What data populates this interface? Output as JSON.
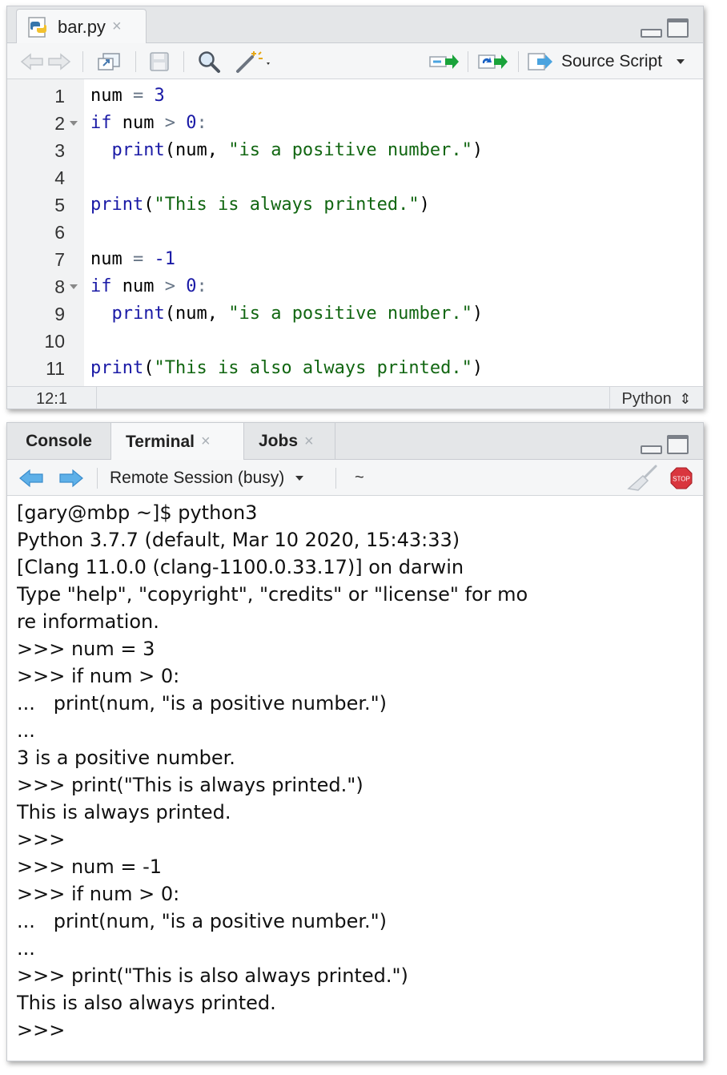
{
  "editor": {
    "file_tab": "bar.py",
    "tab_close": "×",
    "source_script_label": "Source Script",
    "lines": [
      [
        {
          "t": "num",
          "c": "p"
        },
        {
          "t": " ",
          "c": "p"
        },
        {
          "t": "=",
          "c": "op"
        },
        {
          "t": " ",
          "c": "p"
        },
        {
          "t": "3",
          "c": "num"
        }
      ],
      [
        {
          "t": "if",
          "c": "kw"
        },
        {
          "t": " num ",
          "c": "p"
        },
        {
          "t": ">",
          "c": "op"
        },
        {
          "t": " ",
          "c": "p"
        },
        {
          "t": "0",
          "c": "num"
        },
        {
          "t": ":",
          "c": "op"
        }
      ],
      [
        {
          "t": "  ",
          "c": "p"
        },
        {
          "t": "print",
          "c": "fn"
        },
        {
          "t": "(num, ",
          "c": "p"
        },
        {
          "t": "\"is a positive number.\"",
          "c": "str"
        },
        {
          "t": ")",
          "c": "p"
        }
      ],
      [],
      [
        {
          "t": "print",
          "c": "fn"
        },
        {
          "t": "(",
          "c": "p"
        },
        {
          "t": "\"This is always printed.\"",
          "c": "str"
        },
        {
          "t": ")",
          "c": "p"
        }
      ],
      [],
      [
        {
          "t": "num",
          "c": "p"
        },
        {
          "t": " ",
          "c": "p"
        },
        {
          "t": "=",
          "c": "op"
        },
        {
          "t": " ",
          "c": "p"
        },
        {
          "t": "-1",
          "c": "num"
        }
      ],
      [
        {
          "t": "if",
          "c": "kw"
        },
        {
          "t": " num ",
          "c": "p"
        },
        {
          "t": ">",
          "c": "op"
        },
        {
          "t": " ",
          "c": "p"
        },
        {
          "t": "0",
          "c": "num"
        },
        {
          "t": ":",
          "c": "op"
        }
      ],
      [
        {
          "t": "  ",
          "c": "p"
        },
        {
          "t": "print",
          "c": "fn"
        },
        {
          "t": "(num, ",
          "c": "p"
        },
        {
          "t": "\"is a positive number.\"",
          "c": "str"
        },
        {
          "t": ")",
          "c": "p"
        }
      ],
      [],
      [
        {
          "t": "print",
          "c": "fn"
        },
        {
          "t": "(",
          "c": "p"
        },
        {
          "t": "\"This is also always printed.\"",
          "c": "str"
        },
        {
          "t": ")",
          "c": "p"
        }
      ]
    ],
    "line_numbers": [
      "1",
      "2",
      "3",
      "4",
      "5",
      "6",
      "7",
      "8",
      "9",
      "10",
      "11"
    ],
    "fold_lines": [
      2,
      8
    ],
    "cursor_position": "12:1",
    "language": "Python",
    "language_toggle": "⇕"
  },
  "console": {
    "tabs": [
      {
        "label": "Console",
        "close": ""
      },
      {
        "label": "Terminal",
        "close": "×"
      },
      {
        "label": "Jobs",
        "close": "×"
      }
    ],
    "session_label": "Remote Session (busy)",
    "working_dir": "~",
    "stop_label": "STOP",
    "terminal_lines": [
      "[gary@mbp ~]$ python3",
      "Python 3.7.7 (default, Mar 10 2020, 15:43:33)",
      "[Clang 11.0.0 (clang-1100.0.33.17)] on darwin",
      "Type \"help\", \"copyright\", \"credits\" or \"license\" for mo",
      "re information.",
      ">>> num = 3",
      ">>> if num > 0:",
      "...   print(num, \"is a positive number.\")",
      "...",
      "3 is a positive number.",
      ">>> print(\"This is always printed.\")",
      "This is always printed.",
      ">>>",
      ">>> num = -1",
      ">>> if num > 0:",
      "...   print(num, \"is a positive number.\")",
      "...",
      ">>> print(\"This is also always printed.\")",
      "This is also always printed.",
      ">>>"
    ]
  },
  "colors": {
    "keyword": "#1a1aa6",
    "string": "#116611",
    "operator": "#687687",
    "run_arrow": "#1aa33b",
    "nav_arrow": "#4aa3df",
    "stop": "#d9363e"
  },
  "icons": [
    "python-file-icon",
    "back-arrow-icon",
    "forward-arrow-icon",
    "show-in-window-icon",
    "save-icon",
    "search-icon",
    "magic-wand-icon",
    "run-line-icon",
    "rerun-icon",
    "source-icon",
    "broom-icon",
    "stop-icon"
  ]
}
